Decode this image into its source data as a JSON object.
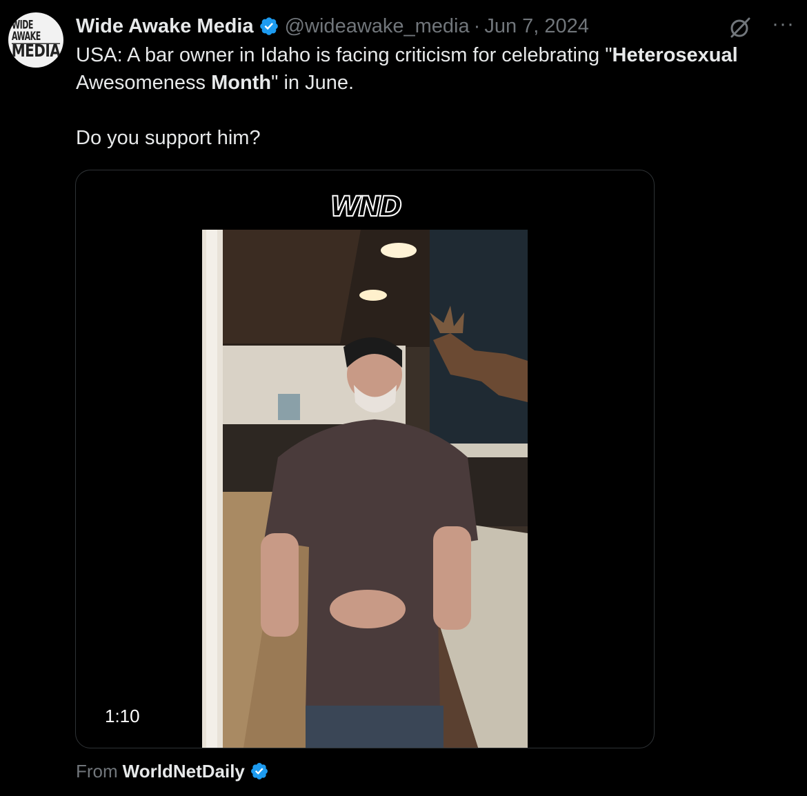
{
  "author": {
    "name": "Wide Awake Media",
    "handle": "@wideawake_media",
    "separator": "·",
    "date": "Jun 7, 2024",
    "avatar_text_line1": "WIDE AWAKE",
    "avatar_text_line2": "MEDIA"
  },
  "tweet": {
    "line1_prefix": "USA: A bar owner in Idaho is facing criticism for celebrating \"",
    "line1_bold": "Heterosexual",
    "line2_prefix": "Awesomeness ",
    "line2_bold": "Month",
    "line2_suffix": "\" in June.",
    "line3": "Do you support him?"
  },
  "media": {
    "watermark": "WND",
    "duration": "1:10"
  },
  "source": {
    "prefix": "From",
    "name": "WorldNetDaily"
  },
  "icons": {
    "verified": "verified-badge-icon",
    "grok": "grok-icon",
    "more": "more-icon"
  },
  "colors": {
    "background": "#000000",
    "text": "#e7e9ea",
    "muted": "#71767b",
    "verified": "#1d9bf0"
  }
}
